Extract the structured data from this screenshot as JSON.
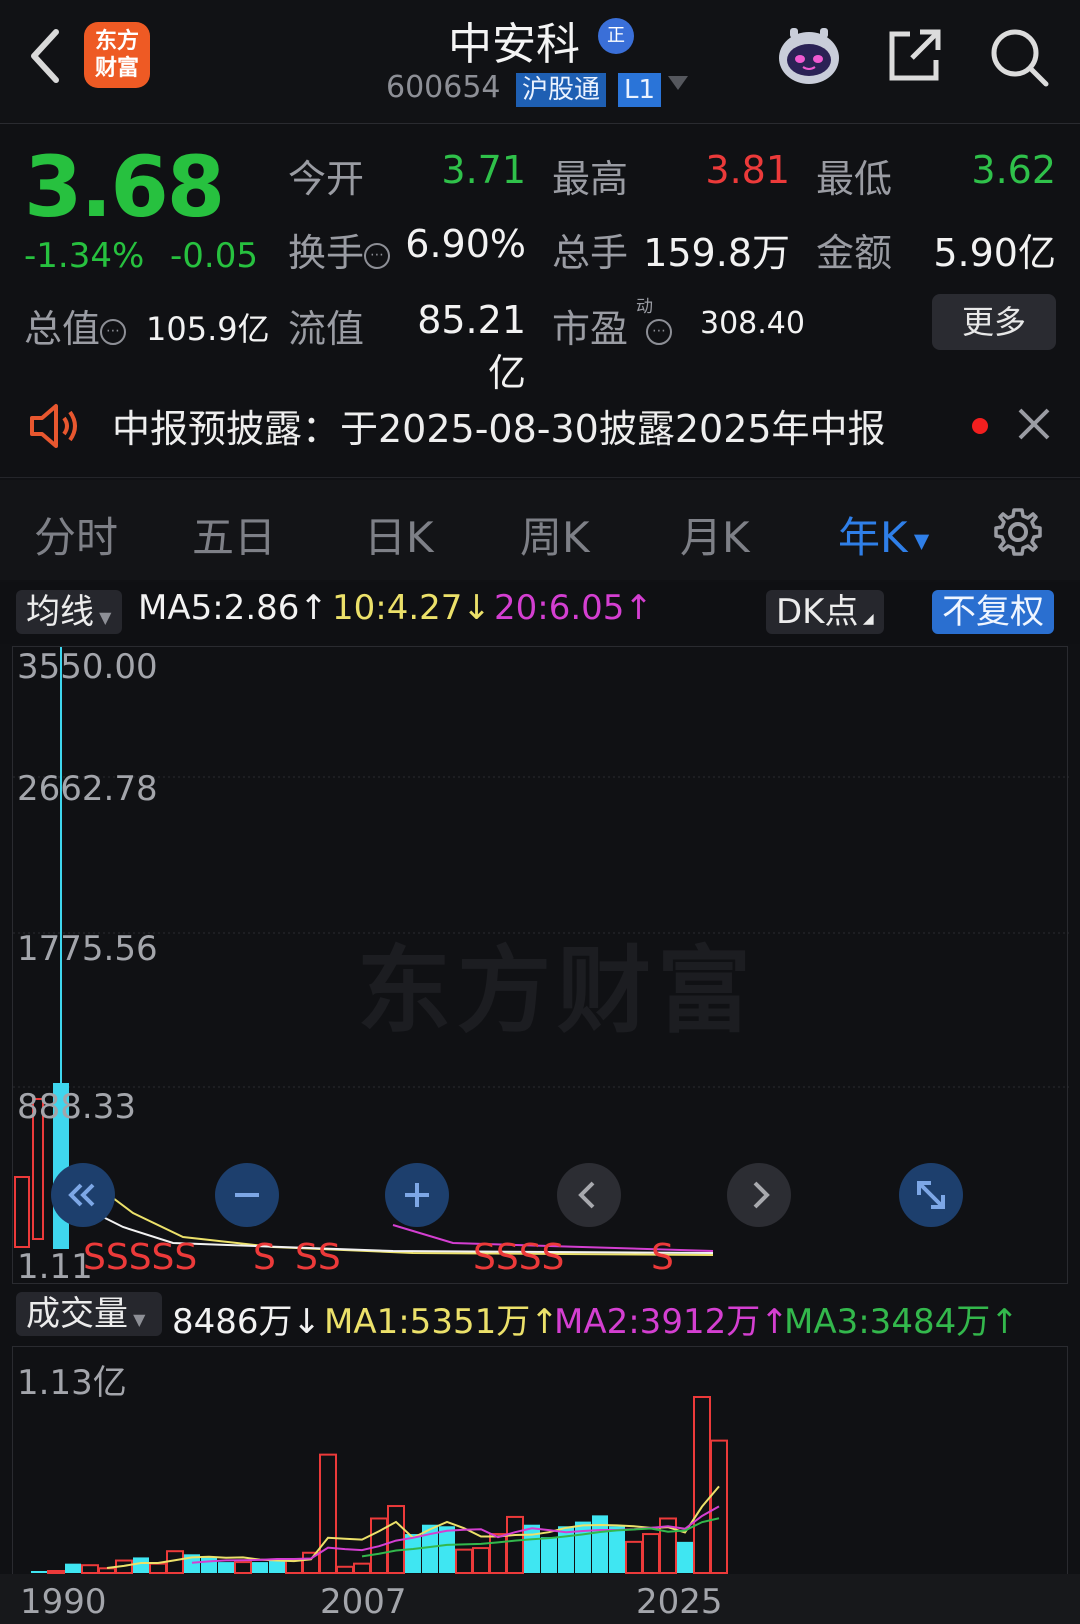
{
  "header": {
    "logo_text_1": "东方",
    "logo_text_2": "财富",
    "title": "中安科",
    "badge": "正",
    "code": "600654",
    "tag_connect": "沪股通",
    "tag_level": "L1"
  },
  "quote": {
    "price": "3.68",
    "change_pct": "-1.34%",
    "change_abs": "-0.05",
    "open_label": "今开",
    "open_value": "3.71",
    "high_label": "最高",
    "high_value": "3.81",
    "low_label": "最低",
    "low_value": "3.62",
    "turnover_label": "换手",
    "turnover_value": "6.90%",
    "volume_label": "总手",
    "volume_value": "159.8万",
    "amount_label": "金额",
    "amount_value": "5.90亿",
    "mktcap_label": "总值",
    "mktcap_value": "105.9亿",
    "float_label": "流值",
    "float_value": "85.21亿",
    "pe_label": "市盈",
    "pe_superscript": "动",
    "pe_value": "308.40",
    "more_button": "更多"
  },
  "notice": {
    "text": "中报预披露：于2025-08-30披露2025年中报"
  },
  "tabs": [
    {
      "label": "分时",
      "selected": false
    },
    {
      "label": "五日",
      "selected": false
    },
    {
      "label": "日K",
      "selected": false
    },
    {
      "label": "周K",
      "selected": false
    },
    {
      "label": "月K",
      "selected": false
    },
    {
      "label": "年K",
      "selected": true
    }
  ],
  "ma_bar": {
    "selector": "均线",
    "ma5": "MA5:2.86↑",
    "ma10": "10:4.27↓",
    "ma20": "20:6.05↑",
    "dk_button": "DK点",
    "adjust_button": "不复权"
  },
  "price_chart": {
    "y_ticks": [
      "3550.00",
      "2662.78",
      "1775.56",
      "888.33",
      "1.11"
    ],
    "watermark": "东方财富",
    "signal_groups": [
      "SSSSS",
      "S",
      "SS",
      "SSSS",
      "S"
    ]
  },
  "volume_bar": {
    "selector": "成交量",
    "current": "8486万↓",
    "ma1": "MA1:5351万↑",
    "ma2": "MA2:3912万↑",
    "ma3": "MA3:3484万↑",
    "y_top": "1.13亿"
  },
  "x_axis": [
    "1990",
    "2007",
    "2025"
  ],
  "colors": {
    "up": "#ec3a3a",
    "down": "#27c13f",
    "accent": "#2f7fe8",
    "ma5": "#f2f2f2",
    "ma10": "#ece16a",
    "ma20": "#d43fd1",
    "ma3": "#33b84c"
  },
  "chart_data": {
    "type": "bar",
    "title": "",
    "x_labels": [
      "1990",
      "2007",
      "2025"
    ],
    "price_axis": {
      "ylim": [
        1.11,
        3550.0
      ],
      "ticks": [
        3550.0,
        2662.78,
        1775.56,
        888.33,
        1.11
      ]
    },
    "volume_axis": {
      "ylim": [
        0,
        1.13
      ],
      "unit": "亿"
    },
    "volume": [
      0.01,
      0.01,
      0.06,
      0.05,
      0.03,
      0.08,
      0.1,
      0.06,
      0.14,
      0.12,
      0.1,
      0.07,
      0.07,
      0.07,
      0.09,
      0.08,
      0.13,
      0.76,
      0.04,
      0.06,
      0.35,
      0.43,
      0.25,
      0.31,
      0.3,
      0.15,
      0.16,
      0.25,
      0.36,
      0.31,
      0.23,
      0.3,
      0.33,
      0.37,
      0.3,
      0.2,
      0.25,
      0.35,
      0.2,
      1.13,
      0.85
    ],
    "volume_up": [
      false,
      true,
      false,
      true,
      true,
      true,
      false,
      true,
      true,
      false,
      false,
      false,
      true,
      false,
      false,
      true,
      true,
      true,
      true,
      true,
      true,
      true,
      false,
      false,
      false,
      true,
      true,
      true,
      true,
      false,
      false,
      false,
      false,
      false,
      false,
      true,
      true,
      true,
      false,
      true,
      true
    ]
  }
}
